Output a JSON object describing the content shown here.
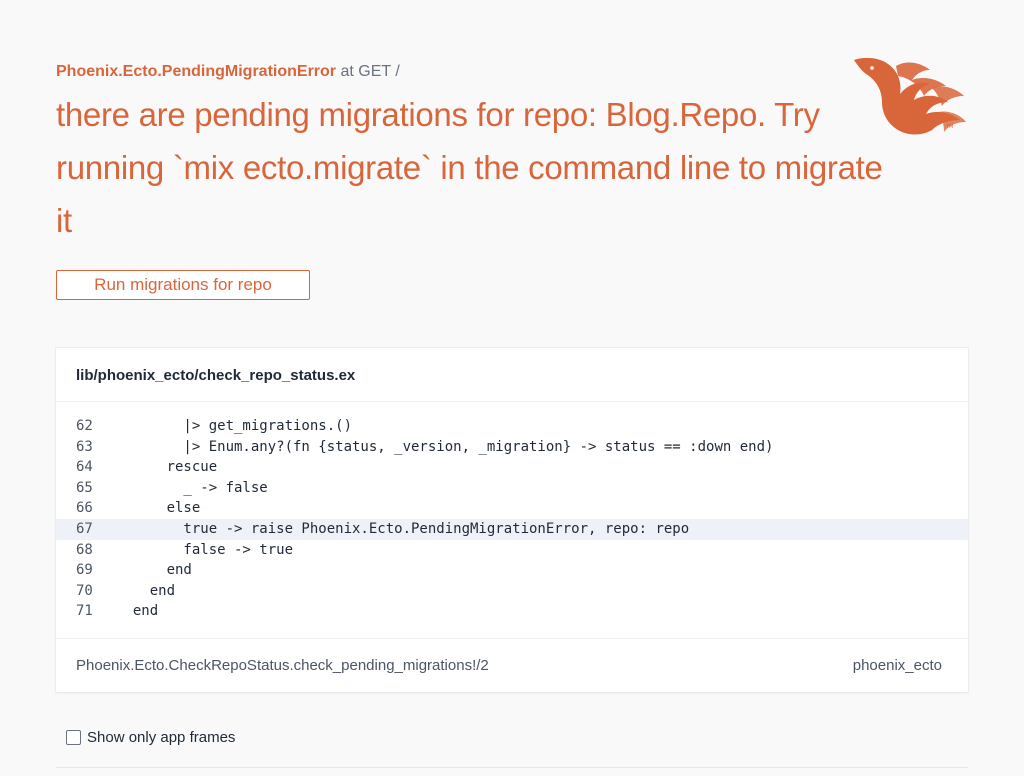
{
  "error": {
    "exception_name": "Phoenix.Ecto.PendingMigrationError",
    "request_info": " at GET /",
    "message": "there are pending migrations for repo: Blog.Repo. Try running `mix ecto.migrate` in the command line to migrate it"
  },
  "action": {
    "run_migrations_label": "Run migrations for repo"
  },
  "code": {
    "file_path": "lib/phoenix_ecto/check_repo_status.ex",
    "lines": [
      {
        "number": "62",
        "code": "        |> get_migrations.()"
      },
      {
        "number": "63",
        "code": "        |> Enum.any?(fn {status, _version, _migration} -> status == :down end)"
      },
      {
        "number": "64",
        "code": "      rescue"
      },
      {
        "number": "65",
        "code": "        _ -> false"
      },
      {
        "number": "66",
        "code": "      else"
      },
      {
        "number": "67",
        "code": "        true -> raise Phoenix.Ecto.PendingMigrationError, repo: repo"
      },
      {
        "number": "68",
        "code": "        false -> true"
      },
      {
        "number": "69",
        "code": "      end"
      },
      {
        "number": "70",
        "code": "    end"
      },
      {
        "number": "71",
        "code": "  end"
      }
    ],
    "highlighted_line": "67",
    "function": "Phoenix.Ecto.CheckRepoStatus.check_pending_migrations!/2",
    "app": "phoenix_ecto"
  },
  "frames": {
    "show_only_app_frames_label": "Show only app frames"
  },
  "colors": {
    "accent": "#d9663b",
    "highlight_row": "#eef2f8",
    "background": "#f9f9fa"
  },
  "icons": {
    "logo": "phoenix-logo-icon"
  }
}
